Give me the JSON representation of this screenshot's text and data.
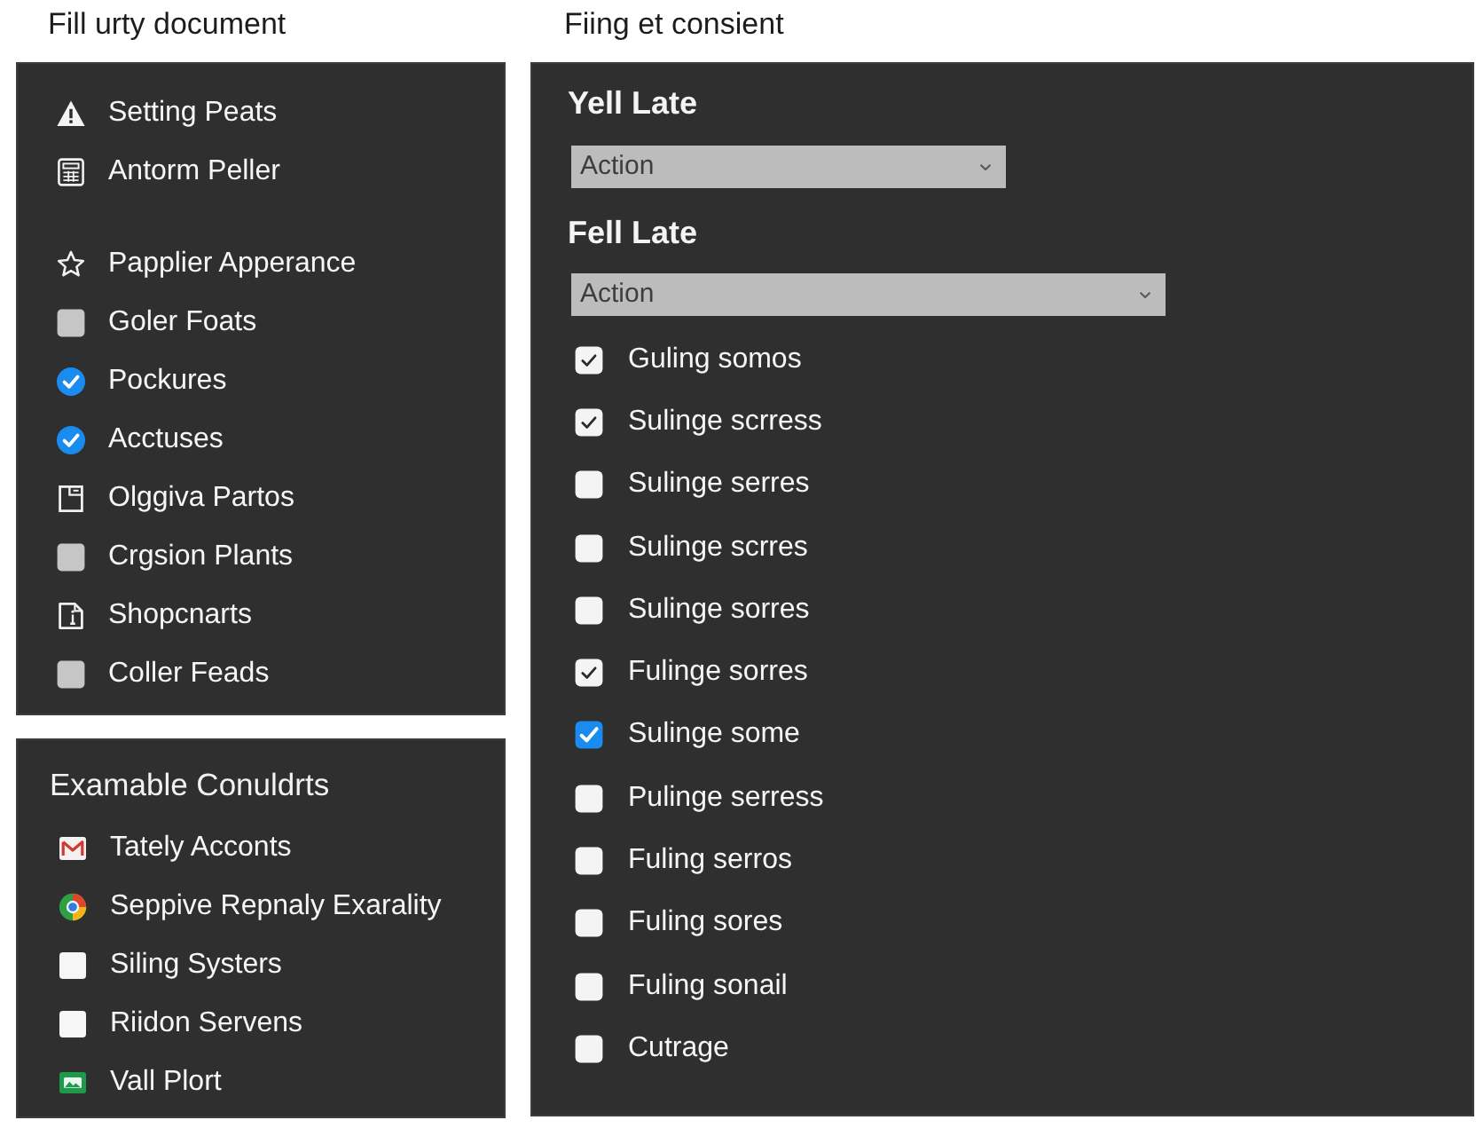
{
  "left_heading": "Fill urty document",
  "sidebar": {
    "groups": [
      {
        "items": [
          {
            "label": "Setting Peats",
            "kind": "alert"
          },
          {
            "label": "Antorm Peller",
            "kind": "form"
          }
        ]
      },
      {
        "items": [
          {
            "label": "Papplier Apperance",
            "kind": "star"
          },
          {
            "label": "Goler Foats",
            "kind": "check",
            "checked": false
          },
          {
            "label": "Pockures",
            "kind": "check",
            "checked": true
          },
          {
            "label": "Acctuses",
            "kind": "check",
            "checked": true
          },
          {
            "label": "Olggiva Partos",
            "kind": "page"
          },
          {
            "label": "Crgsion Plants",
            "kind": "check",
            "checked": false
          },
          {
            "label": "Shopcnarts",
            "kind": "note"
          },
          {
            "label": "Coller Feads",
            "kind": "check",
            "checked": false
          }
        ]
      }
    ]
  },
  "accounts": {
    "title": "Examable Conuldrts",
    "items": [
      {
        "label": "Tately Acconts",
        "kind": "mail"
      },
      {
        "label": "Seppive Repnaly Exarality",
        "kind": "ring"
      },
      {
        "label": "Siling Systers",
        "kind": "tile"
      },
      {
        "label": "Riidon Servens",
        "kind": "tile"
      },
      {
        "label": "Vall Plort",
        "kind": "photo"
      }
    ]
  },
  "right_heading": "Fiing et consient",
  "form": {
    "fields": [
      {
        "label": "Yell Late",
        "value": "Action"
      },
      {
        "label": "Fell Late",
        "value": "Action"
      }
    ],
    "options": [
      {
        "label": "Guling somos",
        "checked": true,
        "accent": false
      },
      {
        "label": "Sulinge scrress",
        "checked": true,
        "accent": false
      },
      {
        "label": "Sulinge serres",
        "checked": false,
        "accent": false
      },
      {
        "label": "Sulinge scrres",
        "checked": false,
        "accent": false
      },
      {
        "label": "Sulinge sorres",
        "checked": false,
        "accent": false
      },
      {
        "label": "Fulinge sorres",
        "checked": true,
        "accent": false
      },
      {
        "label": "Sulinge some",
        "checked": true,
        "accent": true
      },
      {
        "label": "Pulinge serress",
        "checked": false,
        "accent": false
      },
      {
        "label": "Fuling serros",
        "checked": false,
        "accent": false
      },
      {
        "label": "Fuling sores",
        "checked": false,
        "accent": false
      },
      {
        "label": "Fuling sonail",
        "checked": false,
        "accent": false
      },
      {
        "label": "Cutrage",
        "checked": false,
        "accent": false
      }
    ]
  }
}
